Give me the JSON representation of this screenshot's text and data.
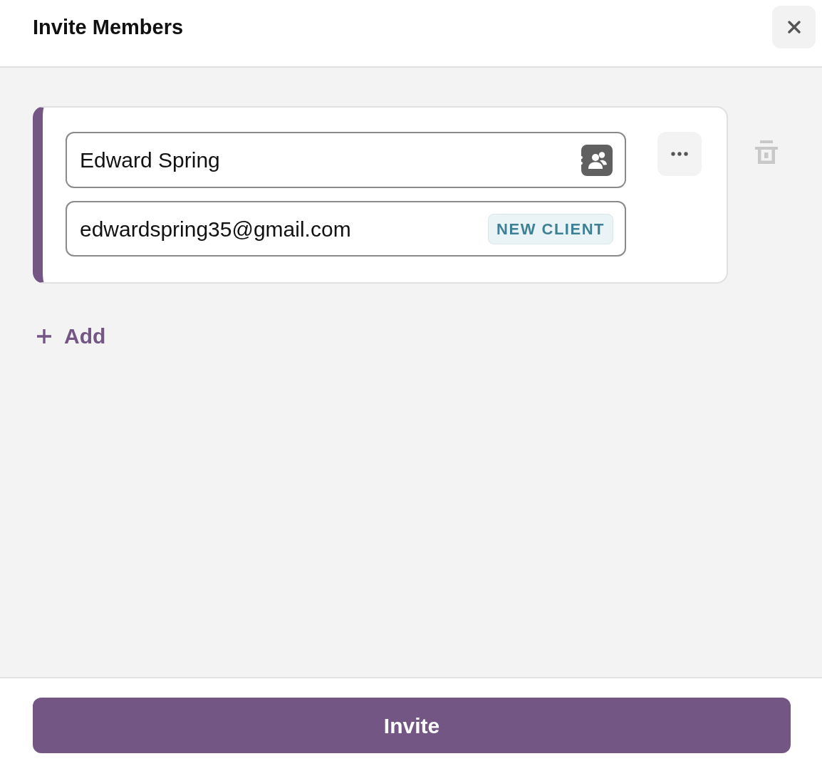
{
  "dialog": {
    "title": "Invite Members"
  },
  "members": [
    {
      "name": "Edward Spring",
      "email": "edwardspring35@gmail.com",
      "tag": "NEW CLIENT"
    }
  ],
  "add_button": {
    "label": "Add"
  },
  "footer": {
    "button": "Invite"
  }
}
